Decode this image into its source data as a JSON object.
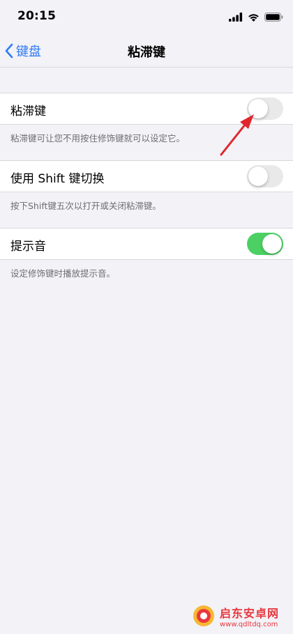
{
  "status": {
    "time": "20:15"
  },
  "nav": {
    "back_label": "键盘",
    "title": "粘滞键"
  },
  "sections": [
    {
      "label": "粘滞键",
      "toggle": "off",
      "footer": "粘滞键可让您不用按住修饰键就可以设定它。"
    },
    {
      "label": "使用 Shift 键切换",
      "toggle": "off",
      "footer": "按下Shift键五次以打开或关闭粘滞键。"
    },
    {
      "label": "提示音",
      "toggle": "on",
      "footer": "设定修饰键时播放提示音。"
    }
  ],
  "watermark": {
    "name": "启东安卓网",
    "url": "www.qdltdq.com"
  },
  "colors": {
    "accent": "#2f7bf5",
    "toggle_on": "#4cd064",
    "toggle_off": "#e9e9ea",
    "arrow": "#e0262d"
  }
}
